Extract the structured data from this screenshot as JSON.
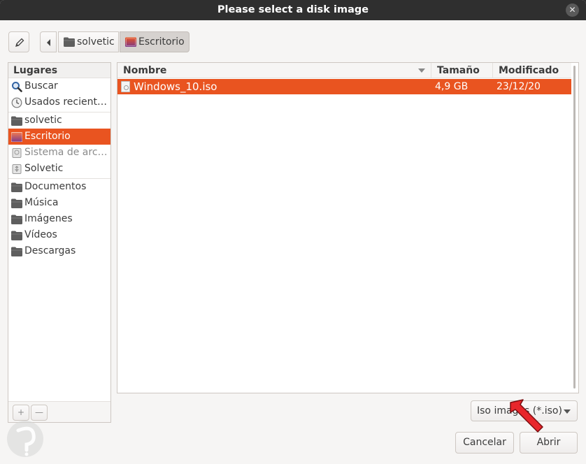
{
  "window": {
    "title": "Please select a disk image",
    "close_glyph": "✕"
  },
  "toolbar": {
    "edit_icon": "pencil-icon",
    "back_icon": "chevron-left-icon",
    "breadcrumbs": [
      {
        "label": "solvetic",
        "icon": "folder-icon"
      },
      {
        "label": "Escritorio",
        "icon": "desktop-folder-icon"
      }
    ]
  },
  "sidebar": {
    "header": "Lugares",
    "items": [
      {
        "label": "Buscar",
        "icon": "search-icon"
      },
      {
        "label": "Usados recient…",
        "icon": "recent-clock-icon"
      },
      {
        "label": "solvetic",
        "icon": "folder-icon"
      },
      {
        "label": "Escritorio",
        "icon": "desktop-folder-icon",
        "selected": true
      },
      {
        "label": "Sistema de arc…",
        "icon": "drive-icon"
      },
      {
        "label": "Solvetic",
        "icon": "usb-drive-icon"
      },
      {
        "label": "Documentos",
        "icon": "folder-icon"
      },
      {
        "label": "Música",
        "icon": "folder-icon"
      },
      {
        "label": "Imágenes",
        "icon": "folder-icon"
      },
      {
        "label": "Vídeos",
        "icon": "folder-icon"
      },
      {
        "label": "Descargas",
        "icon": "folder-icon"
      }
    ],
    "add_glyph": "+",
    "remove_glyph": "—"
  },
  "filelist": {
    "columns": {
      "name": "Nombre",
      "size": "Tamaño",
      "modified": "Modificado"
    },
    "rows": [
      {
        "name": "Windows_10.iso",
        "size": "4,9 GB",
        "modified": "23/12/20",
        "selected": true
      }
    ]
  },
  "footer": {
    "filter_value": "Iso images (*.iso)",
    "cancel_label": "Cancelar",
    "open_label": "Abrir"
  },
  "colors": {
    "accent": "#e95420",
    "titlebar": "#2f2f2f",
    "folder": "#5e5e5e",
    "desktop_folder_top": "#e95420",
    "desktop_folder_bottom": "#7d3a8a"
  }
}
